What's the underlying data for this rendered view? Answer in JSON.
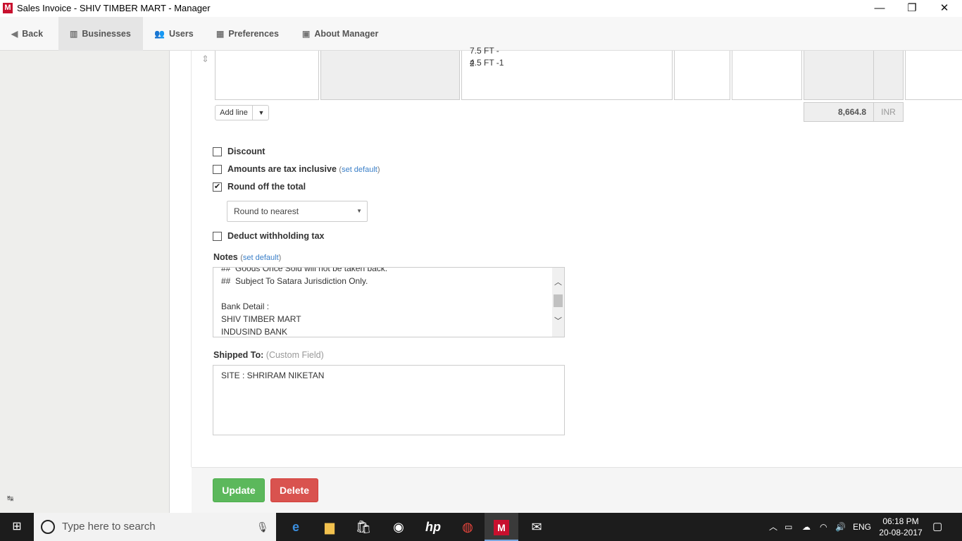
{
  "window": {
    "title": "Sales Invoice - SHIV TIMBER MART - Manager",
    "logo": "M",
    "minimize": "—",
    "restore": "❐",
    "close": "✕"
  },
  "nav": {
    "back": "Back",
    "businesses": "Businesses",
    "users": "Users",
    "preferences": "Preferences",
    "about": "About Manager"
  },
  "line_item": {
    "description_lines": [
      "7.5 FT - 2",
      "4.5 FT -1"
    ]
  },
  "add_line": {
    "label": "Add line"
  },
  "totals": {
    "amount": "8,664.8",
    "currency": "INR"
  },
  "options": {
    "discount": {
      "label": "Discount",
      "checked": false
    },
    "tax_inclusive": {
      "label": "Amounts are tax inclusive",
      "link": "set default",
      "checked": false
    },
    "round_off": {
      "label": "Round off the total",
      "checked": true
    },
    "rounding_select": {
      "value": "Round to nearest"
    },
    "withholding": {
      "label": "Deduct withholding tax",
      "checked": false
    }
  },
  "notes": {
    "label": "Notes",
    "link": "set default",
    "lines": [
      "##  Goods Once Sold will not be taken back.",
      "##  Subject To Satara Jurisdiction Only.",
      "",
      "Bank Detail :",
      "SHIV TIMBER MART",
      "INDUSIND BANK"
    ]
  },
  "shipped_to": {
    "label": "Shipped To:",
    "hint": "(Custom Field)",
    "value": "SITE : SHRIRAM NIKETAN"
  },
  "actions": {
    "update": "Update",
    "delete": "Delete"
  },
  "taskbar": {
    "search_placeholder": "Type here to search",
    "language": "ENG",
    "time": "06:18 PM",
    "date": "20-08-2017",
    "icons": [
      "edge-icon",
      "file-explorer-icon",
      "store-icon",
      "media-icon",
      "hp-icon",
      "chrome-icon",
      "manager-icon",
      "mail-icon"
    ]
  },
  "colors": {
    "update_button": "#5cb85c",
    "delete_button": "#d9534f",
    "link": "#3a7fc8",
    "logo": "#c8102e"
  }
}
